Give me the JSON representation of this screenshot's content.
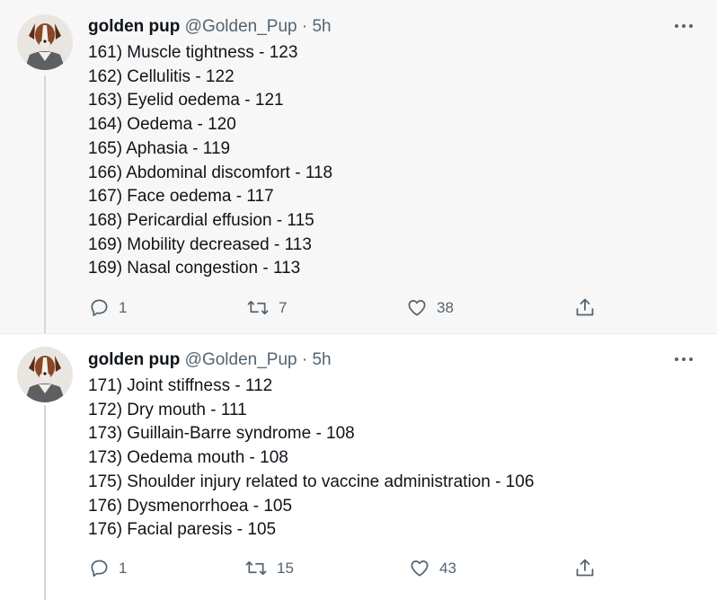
{
  "tweets": [
    {
      "display_name": "golden pup",
      "handle": "@Golden_Pup",
      "time": "· 5h",
      "lines": [
        "161) Muscle tightness - 123",
        "162) Cellulitis - 122",
        "163) Eyelid oedema - 121",
        "164) Oedema - 120",
        "165) Aphasia - 119",
        "166) Abdominal discomfort - 118",
        "167) Face oedema - 117",
        "168) Pericardial effusion - 115",
        "169) Mobility decreased - 113",
        "169) Nasal congestion - 113"
      ],
      "replies": "1",
      "retweets": "7",
      "likes": "38"
    },
    {
      "display_name": "golden pup",
      "handle": "@Golden_Pup",
      "time": "· 5h",
      "lines": [
        "171) Joint stiffness - 112",
        "172) Dry mouth - 111",
        "173) Guillain-Barre syndrome - 108",
        "173) Oedema mouth - 108",
        "175) Shoulder injury related to vaccine administration - 106",
        "176) Dysmenorrhoea - 105",
        "176) Facial paresis - 105"
      ],
      "replies": "1",
      "retweets": "15",
      "likes": "43"
    }
  ],
  "icons": [
    "reply-icon",
    "retweet-icon",
    "like-icon",
    "share-icon",
    "more-icon",
    "avatar"
  ],
  "colors": {
    "icon_gray": "#536471",
    "thread_line": "#cfd9de",
    "tweet1_bg": "#f7f7f7"
  }
}
